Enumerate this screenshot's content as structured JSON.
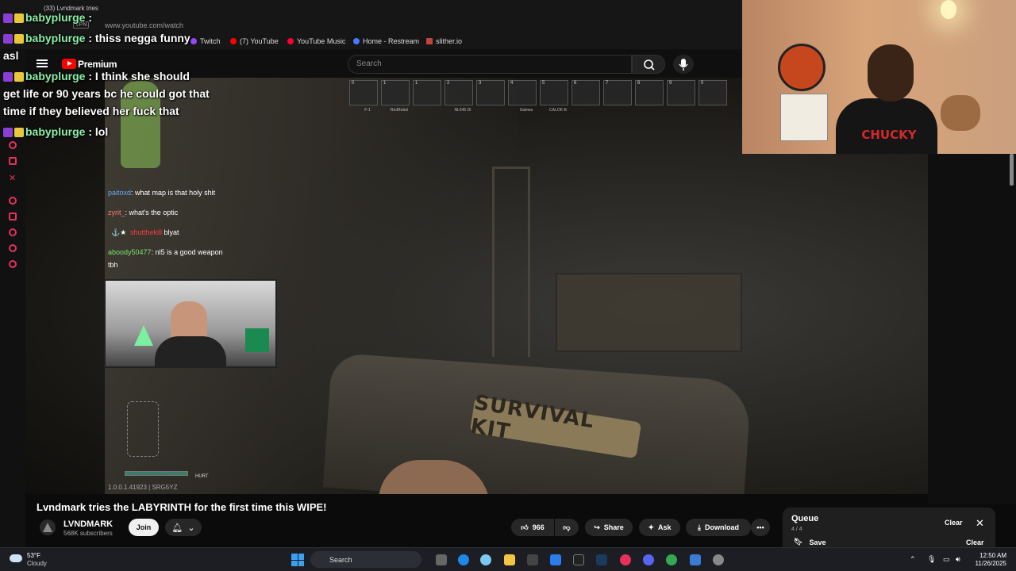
{
  "browser": {
    "tab_title": "(33) Lvndmark tries",
    "url": "www.youtube.com/watch",
    "vpn_label": "VPN",
    "bookmarks": [
      {
        "label": "Twitch",
        "color": "#9146ff"
      },
      {
        "label": "(7) YouTube",
        "color": "#ff0000"
      },
      {
        "label": "YouTube Music",
        "color": "#ff0033"
      },
      {
        "label": "Home - Restream",
        "color": "#4a78ff"
      },
      {
        "label": "slither.io",
        "color": "#c0453a"
      }
    ]
  },
  "overlay_chat": [
    {
      "user": "babyplurge",
      "sep": " : ",
      "msg": ""
    },
    {
      "user": "babyplurge",
      "sep": " : ",
      "msg": "thiss negga funny"
    },
    {
      "user": "",
      "sep": "",
      "msg": "asl"
    },
    {
      "user": "babyplurge",
      "sep": " : ",
      "msg": "I think she should"
    },
    {
      "user": "",
      "sep": "",
      "msg": "get life or 90 years bc he could got that"
    },
    {
      "user": "",
      "sep": "",
      "msg": "time if they believed her fuck that"
    },
    {
      "user": "babyplurge",
      "sep": " : ",
      "msg": "lol"
    }
  ],
  "youtube": {
    "premium_label": "Premium",
    "search_placeholder": "Search"
  },
  "hotbar": [
    {
      "n": "0",
      "label": "F-1"
    },
    {
      "n": "1",
      "label": "RedRebel"
    },
    {
      "n": "1",
      "label": ""
    },
    {
      "n": "2",
      "label": "NL545 DI"
    },
    {
      "n": "3",
      "label": ""
    },
    {
      "n": "4",
      "label": "Salewa"
    },
    {
      "n": "5",
      "label": "CALOK-B"
    },
    {
      "n": "6",
      "label": ""
    },
    {
      "n": "7",
      "label": ""
    },
    {
      "n": "8",
      "label": ""
    },
    {
      "n": "9",
      "label": ""
    },
    {
      "n": "0",
      "label": ""
    }
  ],
  "video_chat": [
    {
      "user": "paitoxd",
      "color": "#6aa6ff",
      "msg": "what map is that holy shit"
    },
    {
      "user": "zyrit_",
      "color": "#ff7b6a",
      "msg": "what's the optic"
    },
    {
      "user": "shutthekill",
      "color": "#ff3a3a",
      "msg": "blyat"
    },
    {
      "user": "aboody50477",
      "color": "#7ee06a",
      "msg": "nl5 is a good weapon"
    },
    {
      "user": "",
      "color": "#ffffff",
      "msg": "tbh"
    }
  ],
  "game": {
    "kit_text": "SURVIVAL KIT",
    "hurt_label": "HURT",
    "version": "1.0.0.1.41923 | SRG5YZ"
  },
  "webcam": {
    "shirt_text": "CHUCKY"
  },
  "video": {
    "title": "Lvndmark tries the LABYRINTH for the first time this WIPE!",
    "channel": "LVNDMARK",
    "subscribers": "568K subscribers",
    "join_label": "Join",
    "likes": "966",
    "share_label": "Share",
    "ask_label": "Ask",
    "download_label": "Download"
  },
  "queue": {
    "title": "Queue",
    "count": "4 / 4",
    "clear_label": "Clear",
    "save_label": "Save",
    "save_clear_label": "Clear"
  },
  "taskbar": {
    "temp": "53°F",
    "condition": "Cloudy",
    "search_label": "Search",
    "time": "12:50 AM",
    "date": "11/26/2025"
  }
}
